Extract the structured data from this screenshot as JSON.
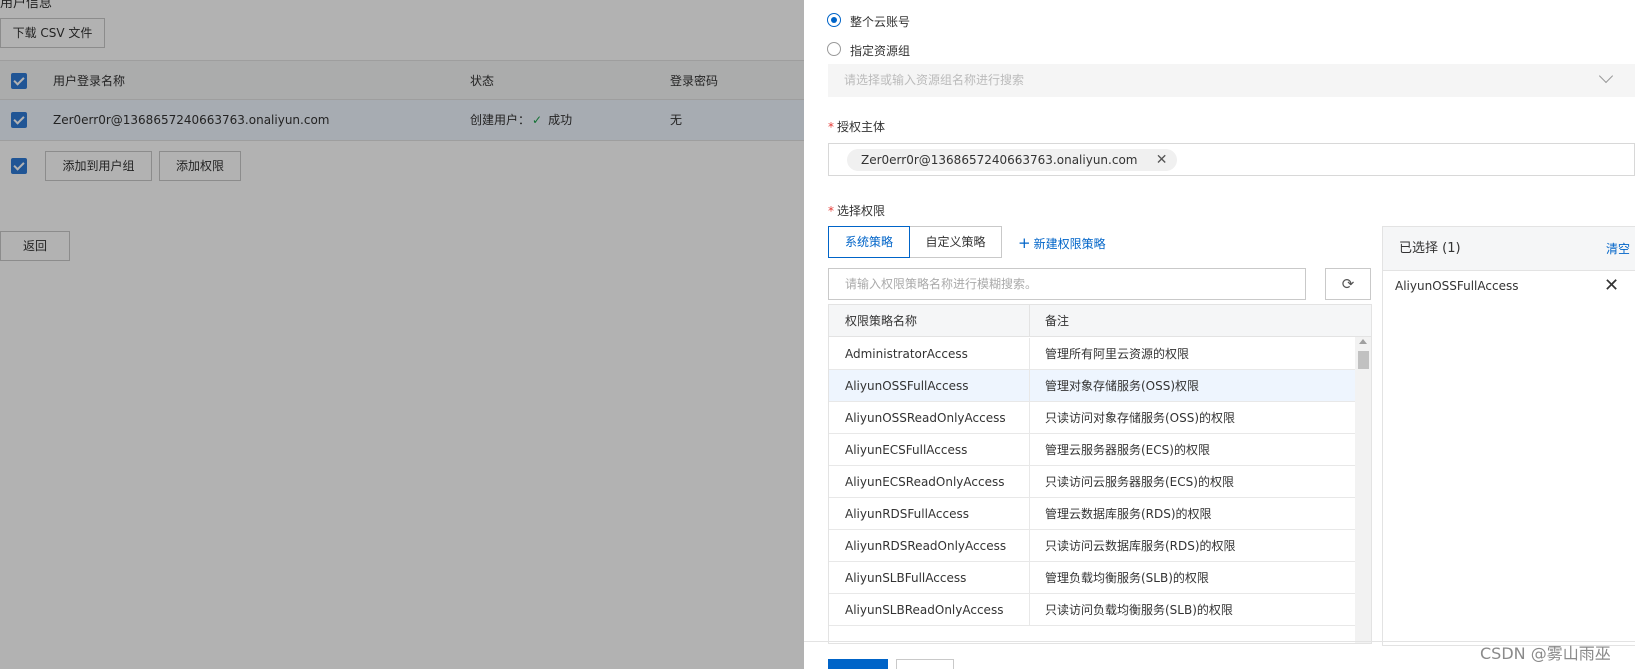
{
  "background": {
    "title_partial": "用户信息",
    "download_button": "下载 CSV 文件",
    "table": {
      "headers": [
        "用户登录名称",
        "状态",
        "登录密码"
      ],
      "row": {
        "login_name": "Zer0err0r@1368657240663763.onaliyun.com",
        "status_prefix": "创建用户：",
        "status_value": "成功",
        "password": "无"
      }
    },
    "add_to_group_button": "添加到用户组",
    "add_permission_button": "添加权限",
    "back_button": "返回"
  },
  "drawer": {
    "scope": {
      "option_whole_account": "整个云账号",
      "option_resource_group": "指定资源组",
      "resource_group_placeholder": "请选择或输入资源组名称进行搜索"
    },
    "principal": {
      "label": "授权主体",
      "tag": "Zer0err0r@1368657240663763.onaliyun.com"
    },
    "permissions": {
      "label": "选择权限",
      "tabs": [
        "系统策略",
        "自定义策略"
      ],
      "new_policy_link": "新建权限策略",
      "search_placeholder": "请输入权限策略名称进行模糊搜索。",
      "headers": [
        "权限策略名称",
        "备注"
      ],
      "rows": [
        {
          "name": "AdministratorAccess",
          "note": "管理所有阿里云资源的权限"
        },
        {
          "name": "AliyunOSSFullAccess",
          "note": "管理对象存储服务(OSS)权限"
        },
        {
          "name": "AliyunOSSReadOnlyAccess",
          "note": "只读访问对象存储服务(OSS)的权限"
        },
        {
          "name": "AliyunECSFullAccess",
          "note": "管理云服务器服务(ECS)的权限"
        },
        {
          "name": "AliyunECSReadOnlyAccess",
          "note": "只读访问云服务器服务(ECS)的权限"
        },
        {
          "name": "AliyunRDSFullAccess",
          "note": "管理云数据库服务(RDS)的权限"
        },
        {
          "name": "AliyunRDSReadOnlyAccess",
          "note": "只读访问云数据库服务(RDS)的权限"
        },
        {
          "name": "AliyunSLBFullAccess",
          "note": "管理负载均衡服务(SLB)的权限"
        },
        {
          "name": "AliyunSLBReadOnlyAccess",
          "note": "只读访问负载均衡服务(SLB)的权限"
        }
      ]
    },
    "selected": {
      "title": "已选择",
      "count": "(1)",
      "clear": "清空",
      "items": [
        "AliyunOSSFullAccess"
      ]
    }
  },
  "watermark": "CSDN @雾山雨巫"
}
